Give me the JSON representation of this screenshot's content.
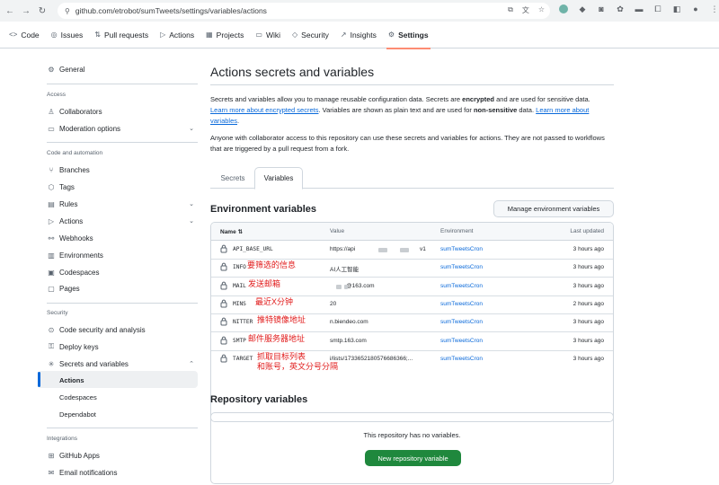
{
  "browser": {
    "url": "github.com/etrobot/sumTweets/settings/variables/actions"
  },
  "repo_nav": {
    "tabs": [
      {
        "label": "Code",
        "icon": "<>"
      },
      {
        "label": "Issues",
        "icon": "◎"
      },
      {
        "label": "Pull requests",
        "icon": "⇅"
      },
      {
        "label": "Actions",
        "icon": "▷"
      },
      {
        "label": "Projects",
        "icon": "▦"
      },
      {
        "label": "Wiki",
        "icon": "▭"
      },
      {
        "label": "Security",
        "icon": "◇"
      },
      {
        "label": "Insights",
        "icon": "↗"
      },
      {
        "label": "Settings",
        "icon": "⚙"
      }
    ],
    "active": "Settings"
  },
  "sidebar": {
    "general": "General",
    "access_heading": "Access",
    "collaborators": "Collaborators",
    "moderation": "Moderation options",
    "code_heading": "Code and automation",
    "branches": "Branches",
    "tags": "Tags",
    "rules": "Rules",
    "actions": "Actions",
    "webhooks": "Webhooks",
    "environments": "Environments",
    "codespaces": "Codespaces",
    "pages": "Pages",
    "security_heading": "Security",
    "code_security": "Code security and analysis",
    "deploy_keys": "Deploy keys",
    "secrets_vars": "Secrets and variables",
    "sub_actions": "Actions",
    "sub_codespaces": "Codespaces",
    "sub_dependabot": "Dependabot",
    "integrations_heading": "Integrations",
    "github_apps": "GitHub Apps",
    "email_notifications": "Email notifications"
  },
  "main": {
    "title": "Actions secrets and variables",
    "desc1_a": "Secrets and variables allow you to manage reusable configuration data. Secrets are ",
    "desc1_b": "encrypted",
    "desc1_c": " and are used for sensitive data. ",
    "desc1_link1": "Learn more about encrypted secrets",
    "desc1_d": ". Variables are shown as plain text and are used for ",
    "desc1_e": "non-sensitive",
    "desc1_f": " data. ",
    "desc1_link2": "Learn more about variables",
    "desc1_g": ".",
    "desc2": "Anyone with collaborator access to this repository can use these secrets and variables for actions. They are not passed to workflows that are triggered by a pull request from a fork.",
    "tab_secrets": "Secrets",
    "tab_variables": "Variables",
    "env_title": "Environment variables",
    "manage_env_btn": "Manage environment variables",
    "columns": {
      "name": "Name ⇅",
      "value": "Value",
      "environment": "Environment",
      "updated": "Last updated"
    },
    "rows": [
      {
        "name": "API_BASE_URL",
        "value": "https://api",
        "value_end": "v1",
        "env": "sumTweetsCron",
        "updated": "3 hours ago",
        "note": ""
      },
      {
        "name": "INFO",
        "value": "AI人工智能",
        "value_end": "",
        "env": "sumTweetsCron",
        "updated": "3 hours ago",
        "note": "要筛选的信息"
      },
      {
        "name": "MAIL",
        "value": "",
        "value_end": "@163.com",
        "env": "sumTweetsCron",
        "updated": "3 hours ago",
        "note": "发送邮箱"
      },
      {
        "name": "MINS",
        "value": "20",
        "value_end": "",
        "env": "sumTweetsCron",
        "updated": "2 hours ago",
        "note": "最近X分钟"
      },
      {
        "name": "NITTER",
        "value": "n.biendeo.com",
        "value_end": "",
        "env": "sumTweetsCron",
        "updated": "3 hours ago",
        "note": "推特镜像地址"
      },
      {
        "name": "SMTP",
        "value": "smtp.163.com",
        "value_end": "",
        "env": "sumTweetsCron",
        "updated": "3 hours ago",
        "note": "邮件服务器地址"
      },
      {
        "name": "TARGET",
        "value": "i/lists/1733652180576686366;...",
        "value_end": "",
        "env": "sumTweetsCron",
        "updated": "3 hours ago",
        "note": "抓取目标列表\n和账号，英文分号分隔"
      }
    ],
    "repo_title": "Repository variables",
    "empty_text": "This repository has no variables.",
    "new_btn": "New repository variable"
  },
  "colors": {
    "accent": "#0969da",
    "green": "#1f883d",
    "annotation": "#e11b1b",
    "tab_underline": "#fd8c73"
  }
}
